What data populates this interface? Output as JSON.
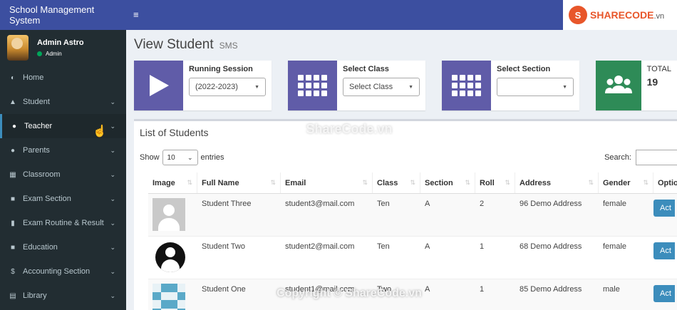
{
  "app": {
    "brand": "School Management System",
    "menu_toggle": "≡"
  },
  "user": {
    "name": "Admin Astro",
    "role": "Admin"
  },
  "sidebar": {
    "items": [
      {
        "label": "Home",
        "icon": "dashboard-icon"
      },
      {
        "label": "Student",
        "icon": "graduation-cap-icon"
      },
      {
        "label": "Teacher",
        "icon": "users-icon"
      },
      {
        "label": "Parents",
        "icon": "user-icon"
      },
      {
        "label": "Classroom",
        "icon": "grid-icon"
      },
      {
        "label": "Exam Section",
        "icon": "book-icon"
      },
      {
        "label": "Exam Routine & Result",
        "icon": "file-icon"
      },
      {
        "label": "Education",
        "icon": "book-open-icon"
      },
      {
        "label": "Accounting Section",
        "icon": "dollar-icon"
      },
      {
        "label": "Library",
        "icon": "library-icon"
      }
    ]
  },
  "logo": {
    "mark": "S",
    "name": "SHARECODE",
    "suffix": ".vn"
  },
  "page": {
    "title": "View Student",
    "subtitle": "SMS"
  },
  "info": {
    "session_label": "Running Session",
    "session_value": "(2022-2023)",
    "class_label": "Select Class",
    "class_value": "Select Class",
    "section_label": "Select Section",
    "section_value": "",
    "total_label": "TOTAL",
    "total_value": "19",
    "colors": {
      "blue": "#605ca8",
      "green": "#2e8b57"
    }
  },
  "list": {
    "title": "List of Students",
    "show_label": "Show",
    "entries_value": "10",
    "entries_label": "entries",
    "search_label": "Search:",
    "columns": [
      "Image",
      "Full Name",
      "Email",
      "Class",
      "Section",
      "Roll",
      "Address",
      "Gender",
      "Optio"
    ],
    "rows": [
      {
        "name": "Student Three",
        "email": "student3@mail.com",
        "class": "Ten",
        "section": "A",
        "roll": "2",
        "address": "96 Demo Address",
        "gender": "female",
        "action": "Act"
      },
      {
        "name": "Student Two",
        "email": "student2@mail.com",
        "class": "Ten",
        "section": "A",
        "roll": "1",
        "address": "68 Demo Address",
        "gender": "female",
        "action": "Act"
      },
      {
        "name": "Student One",
        "email": "student1@mail.com",
        "class": "Two",
        "section": "A",
        "roll": "1",
        "address": "85 Demo Address",
        "gender": "male",
        "action": "Act"
      }
    ]
  },
  "watermark": {
    "center": "ShareCode.vn",
    "bottom": "Copyright © ShareCode.vn"
  }
}
